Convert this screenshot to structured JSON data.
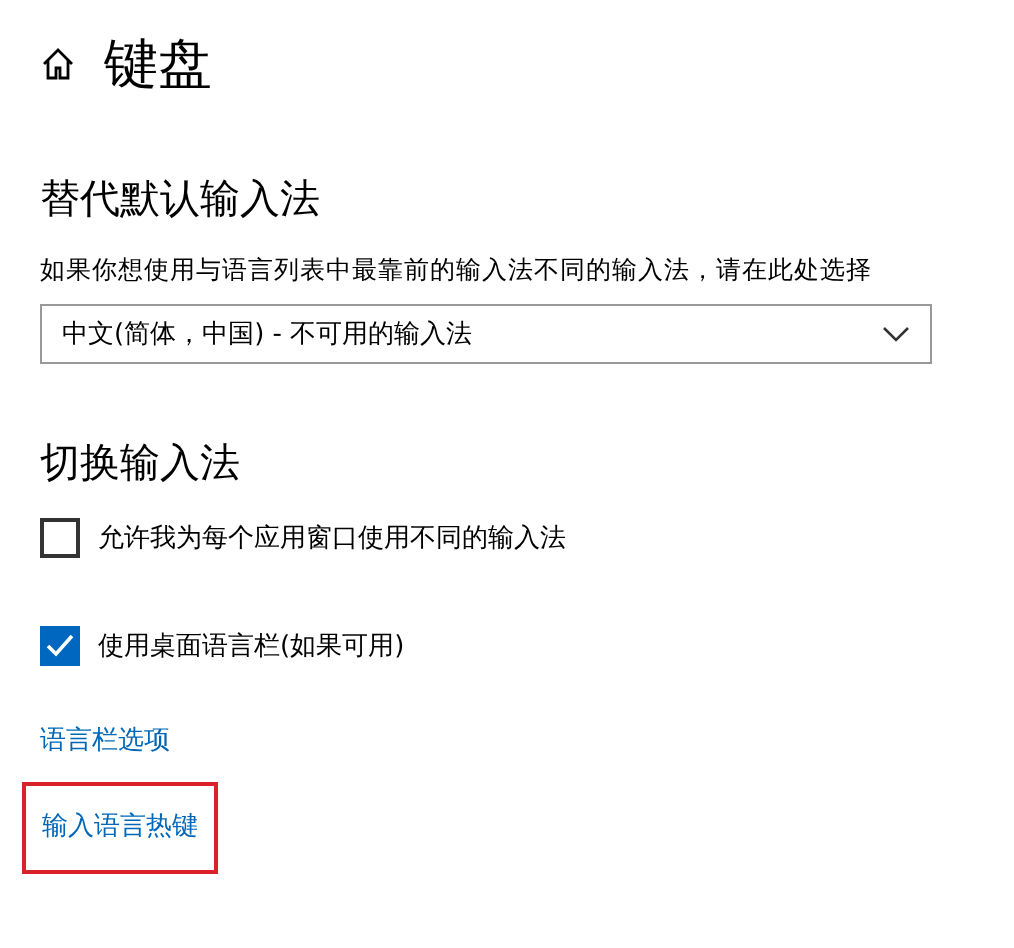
{
  "page": {
    "title": "键盘"
  },
  "sections": [
    {
      "heading": "替代默认输入法",
      "items": [
        {
          "kind": "text",
          "text": "如果你想使用与语言列表中最靠前的输入法不同的输入法，请在此处选择"
        },
        {
          "kind": "dropdown",
          "value": "中文(简体，中国) - 不可用的输入法"
        }
      ]
    },
    {
      "heading": "切换输入法",
      "items": [
        {
          "kind": "checkbox",
          "label": "允许我为每个应用窗口使用不同的输入法",
          "checked": false
        },
        {
          "kind": "checkbox",
          "label": "使用桌面语言栏(如果可用)",
          "checked": true
        }
      ]
    }
  ],
  "links": [
    {
      "label": "语言栏选项",
      "highlighted": false
    },
    {
      "label": "输入语言热键",
      "highlighted": true
    }
  ]
}
